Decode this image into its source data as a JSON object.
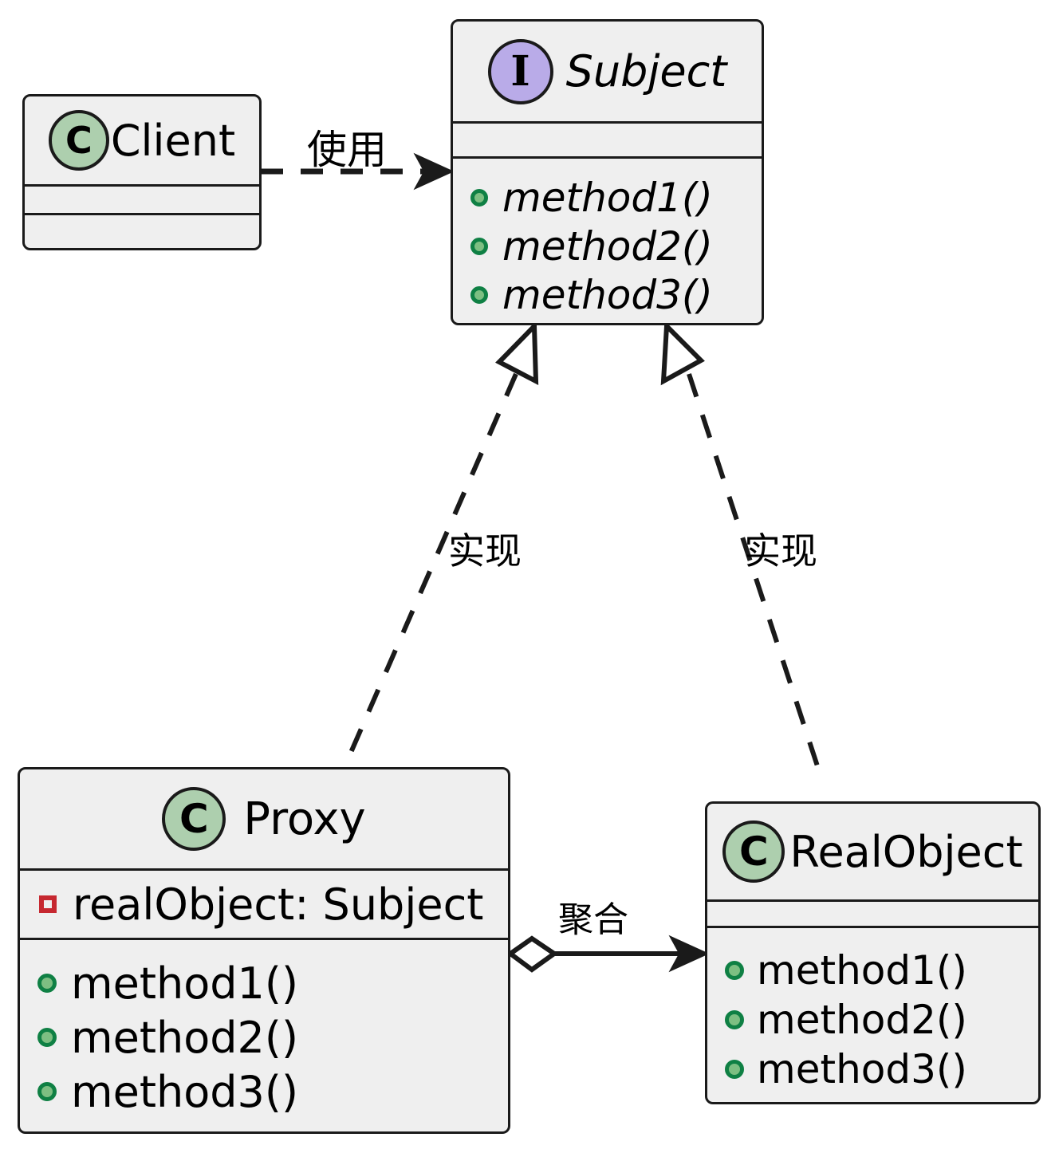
{
  "diagram": {
    "title": "Proxy Pattern UML Class Diagram",
    "colors": {
      "box_fill": "#EFEFEF",
      "box_stroke": "#1A1A1A",
      "class_icon_fill": "#ADCFAE",
      "interface_icon_fill": "#B9ABE8",
      "method_bullet_fill": "#7DBF82",
      "method_bullet_stroke": "#0F8044",
      "private_field_stroke": "#C62830",
      "edge_stroke": "#1A1A1A"
    }
  },
  "nodes": {
    "client": {
      "name": "Client",
      "stereotype_letter": "C",
      "stereotype": "class",
      "icon_name": "class-stereotype-icon",
      "attributes": [],
      "methods": []
    },
    "subject": {
      "name": "Subject",
      "stereotype_letter": "I",
      "stereotype": "interface",
      "icon_name": "interface-stereotype-icon",
      "attributes": [],
      "methods": [
        {
          "label": "method1()",
          "visibility": "public",
          "bullet": "green-dot"
        },
        {
          "label": "method2()",
          "visibility": "public",
          "bullet": "green-dot"
        },
        {
          "label": "method3()",
          "visibility": "public",
          "bullet": "green-dot"
        }
      ]
    },
    "proxy": {
      "name": "Proxy",
      "stereotype_letter": "C",
      "stereotype": "class",
      "icon_name": "class-stereotype-icon",
      "attributes": [
        {
          "label": "realObject: Subject",
          "visibility": "private",
          "bullet": "red-square"
        }
      ],
      "methods": [
        {
          "label": "method1()",
          "visibility": "public",
          "bullet": "green-dot"
        },
        {
          "label": "method2()",
          "visibility": "public",
          "bullet": "green-dot"
        },
        {
          "label": "method3()",
          "visibility": "public",
          "bullet": "green-dot"
        }
      ]
    },
    "realobject": {
      "name": "RealObject",
      "stereotype_letter": "C",
      "stereotype": "class",
      "icon_name": "class-stereotype-icon",
      "attributes": [],
      "methods": [
        {
          "label": "method1()",
          "visibility": "public",
          "bullet": "green-dot"
        },
        {
          "label": "method2()",
          "visibility": "public",
          "bullet": "green-dot"
        },
        {
          "label": "method3()",
          "visibility": "public",
          "bullet": "green-dot"
        }
      ]
    }
  },
  "edges": {
    "client_uses_subject": {
      "label": "使用",
      "type": "dependency",
      "from": "Client",
      "to": "Subject",
      "line": "dashed",
      "arrowhead": "filled-open-arrow"
    },
    "proxy_implements_subject": {
      "label": "实现",
      "type": "realization",
      "from": "Proxy",
      "to": "Subject",
      "line": "dashed",
      "arrowhead": "hollow-triangle"
    },
    "realobject_implements_subject": {
      "label": "实现",
      "type": "realization",
      "from": "RealObject",
      "to": "Subject",
      "line": "dashed",
      "arrowhead": "hollow-triangle"
    },
    "proxy_aggregates_realobject": {
      "label": "聚合",
      "type": "aggregation",
      "from": "Proxy",
      "to": "RealObject",
      "line": "solid",
      "arrowhead": "filled-open-arrow",
      "tail": "hollow-diamond"
    }
  }
}
